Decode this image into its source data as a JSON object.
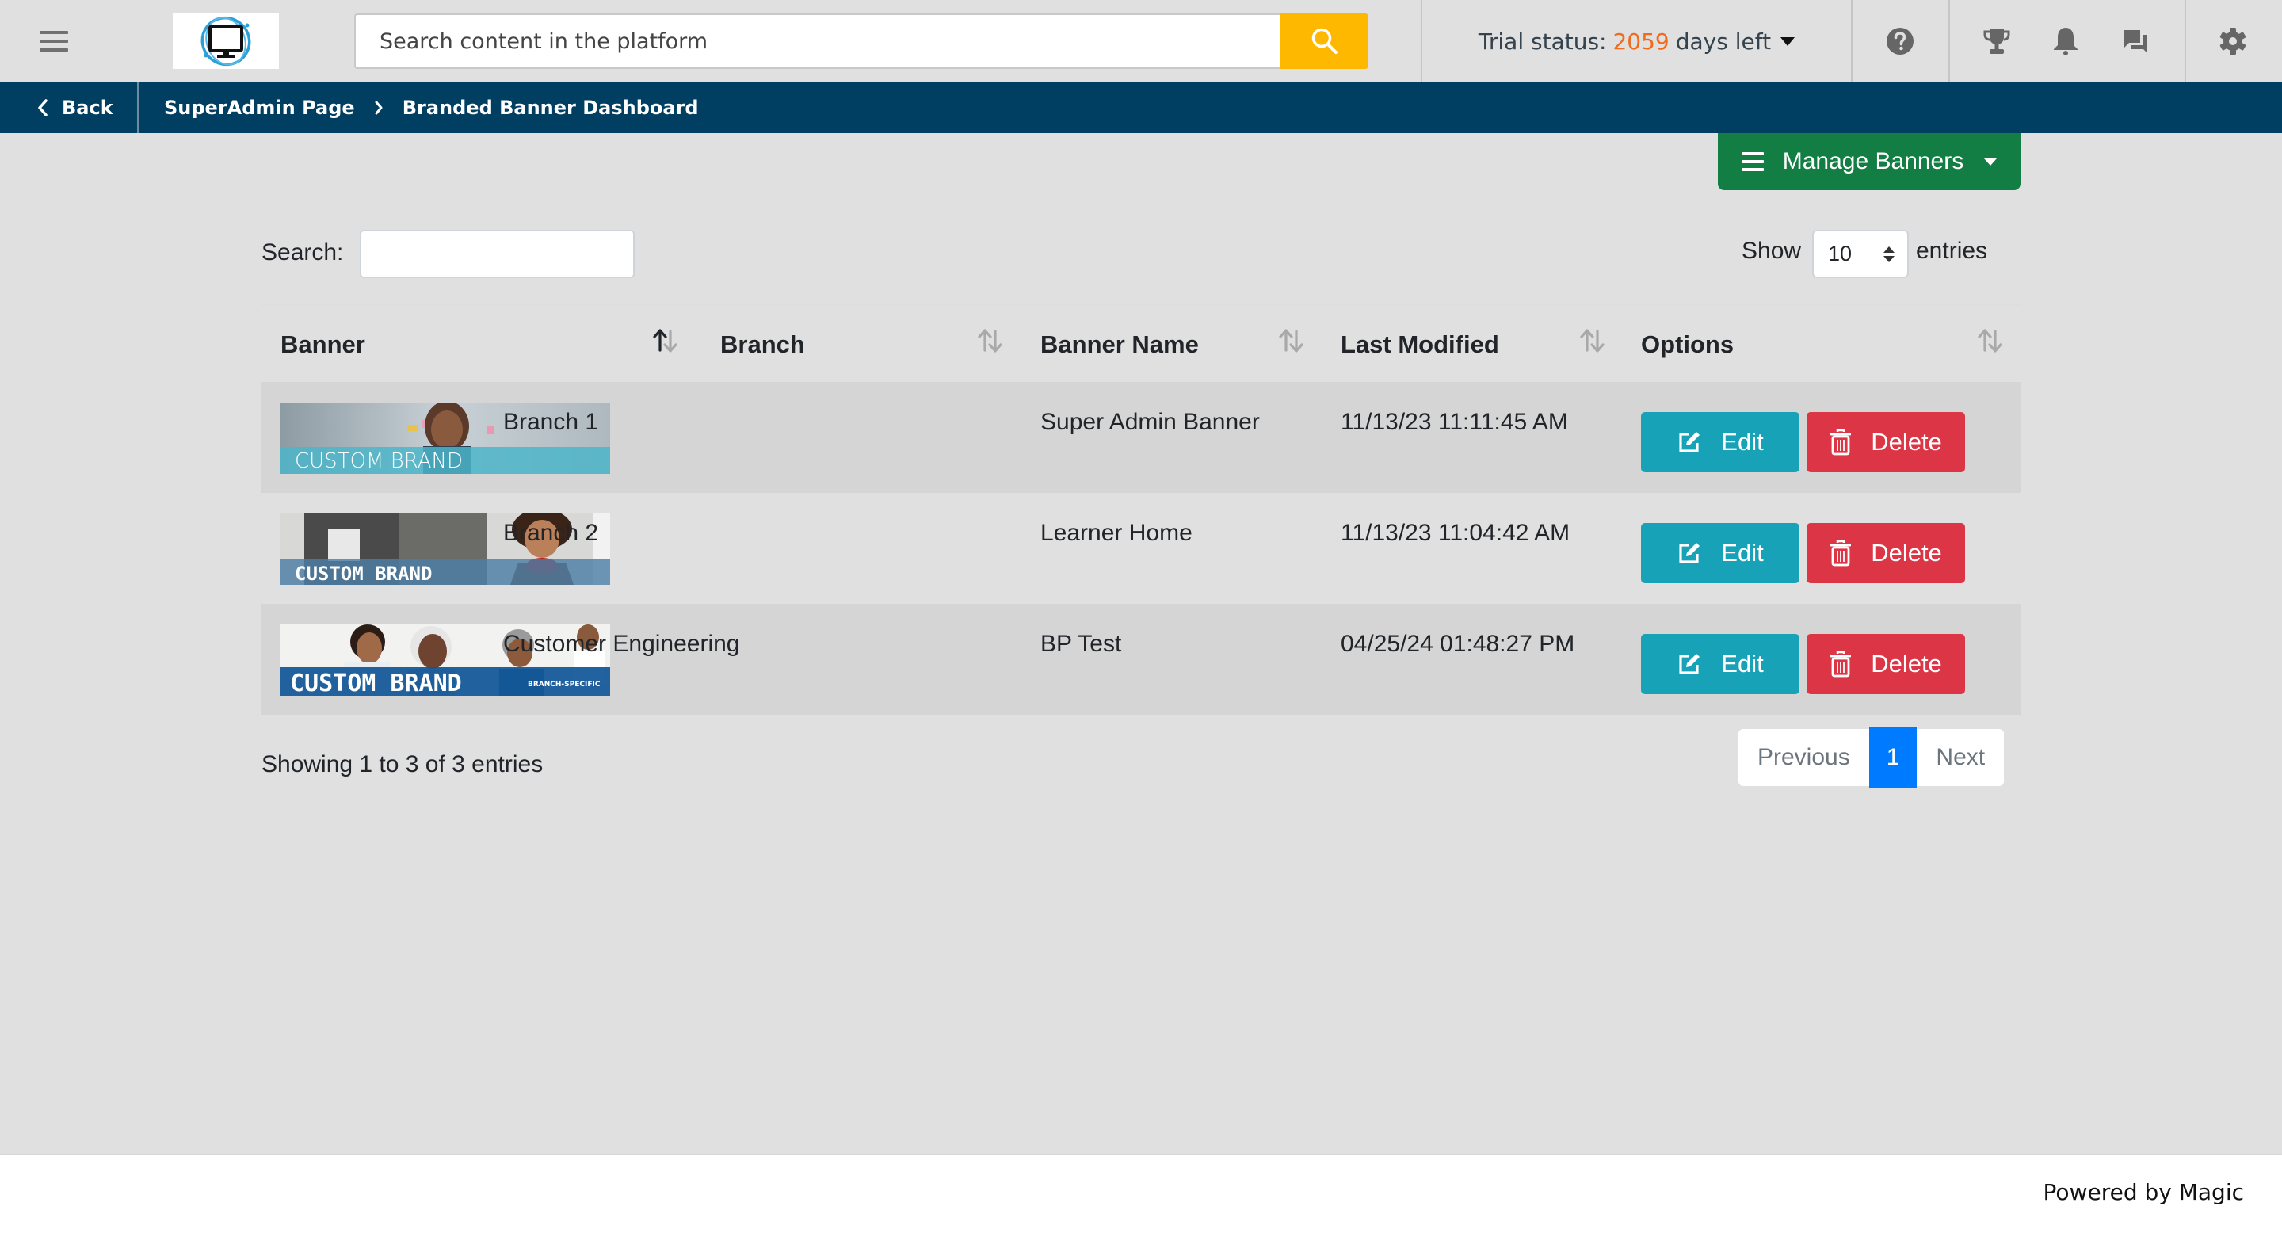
{
  "header": {
    "menu_icon": "hamburger-icon",
    "logo_alt": "Monitor logo",
    "search_placeholder": "Search content in the platform",
    "search_value": "",
    "search_icon": "search-icon",
    "trial_prefix": "Trial status:",
    "trial_days": "2059",
    "trial_suffix": "days left",
    "icons": [
      "help-icon",
      "trophy-icon",
      "bell-icon",
      "chat-icon",
      "gear-icon"
    ]
  },
  "breadcrumb": {
    "back_label": "Back",
    "items": [
      "SuperAdmin Page",
      "Branded Banner Dashboard"
    ]
  },
  "actions": {
    "manage_banners_label": "Manage Banners"
  },
  "table_controls": {
    "search_label": "Search:",
    "search_value": "",
    "show_label": "Show",
    "page_length": "10",
    "entries_label": "entries"
  },
  "table": {
    "columns": [
      "Banner",
      "Branch",
      "Banner Name",
      "Last Modified",
      "Options"
    ],
    "sorted_column": "Banner",
    "sort_direction": "ascending",
    "rows": [
      {
        "banner_text": "CUSTOM BRAND",
        "banner_subtext": "",
        "branch": "Branch 1",
        "banner_name": "Super Admin Banner",
        "last_modified": "11/13/23 11:11:45 AM"
      },
      {
        "banner_text": "CUSTOM BRAND",
        "banner_subtext": "",
        "branch": "Branch 2",
        "banner_name": "Learner Home",
        "last_modified": "11/13/23 11:04:42 AM"
      },
      {
        "banner_text": "CUSTOM BRAND",
        "banner_subtext": "BRANCH-SPECIFIC",
        "branch": "Customer Engineering",
        "banner_name": "BP Test",
        "last_modified": "04/25/24 01:48:27 PM"
      }
    ],
    "edit_label": "Edit",
    "delete_label": "Delete"
  },
  "pagination": {
    "info": "Showing 1 to 3 of 3 entries",
    "previous_label": "Previous",
    "current_page": "1",
    "next_label": "Next"
  },
  "footer": {
    "powered_by": "Powered by Magic"
  },
  "colors": {
    "accent_search": "#ffb800",
    "trial_days": "#f26a1b",
    "breadcrumb_bg": "#003e62",
    "manage_button": "#137e43",
    "edit_button": "#17a2b8",
    "delete_button": "#dc3545",
    "active_page": "#007bff"
  }
}
